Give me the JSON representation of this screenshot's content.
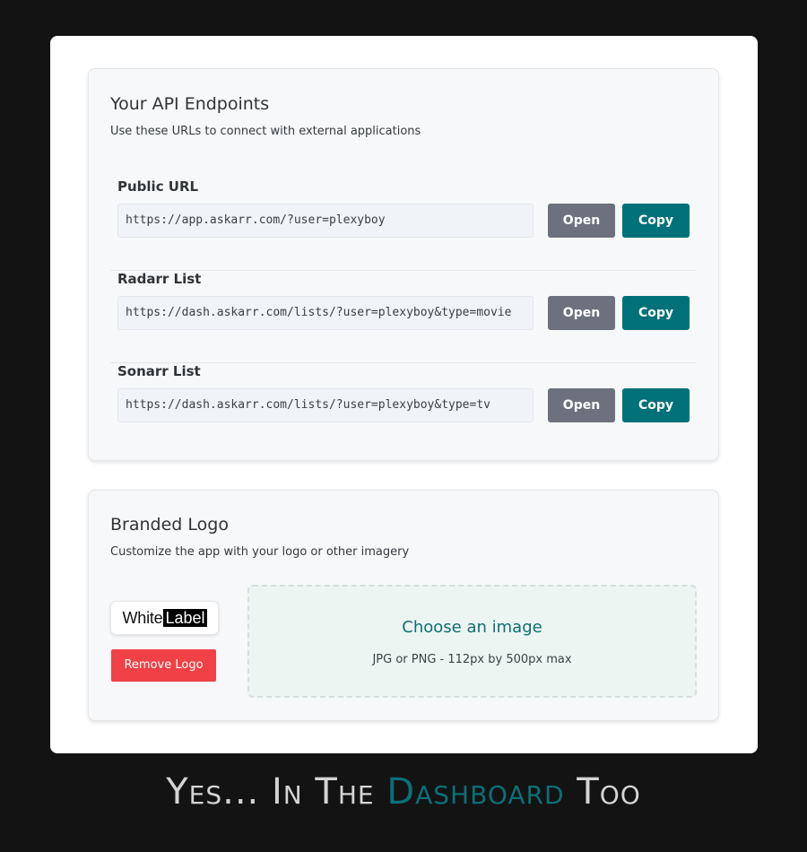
{
  "api_card": {
    "title": "Your API Endpoints",
    "subtitle": "Use these URLs to connect with external applications",
    "endpoints": [
      {
        "label": "Public URL",
        "url": "https://app.askarr.com/?user=plexyboy",
        "open_label": "Open",
        "copy_label": "Copy"
      },
      {
        "label": "Radarr List",
        "url": "https://dash.askarr.com/lists/?user=plexyboy&type=movie",
        "open_label": "Open",
        "copy_label": "Copy"
      },
      {
        "label": "Sonarr List",
        "url": "https://dash.askarr.com/lists/?user=plexyboy&type=tv",
        "open_label": "Open",
        "copy_label": "Copy"
      }
    ]
  },
  "brand_card": {
    "title": "Branded Logo",
    "subtitle": "Customize the app with your logo or other imagery",
    "logo_text_1": "White",
    "logo_text_2": "Label",
    "remove_label": "Remove Logo",
    "dropzone_title": "Choose an image",
    "dropzone_hint": "JPG or PNG - 112px by 500px max"
  },
  "tagline": {
    "part1": "Yes... In The",
    "highlight": "Dashboard",
    "part2": "Too"
  },
  "colors": {
    "accent": "#007178",
    "open_button": "#6c717d",
    "remove_button": "#ef4146",
    "background": "#131313"
  }
}
